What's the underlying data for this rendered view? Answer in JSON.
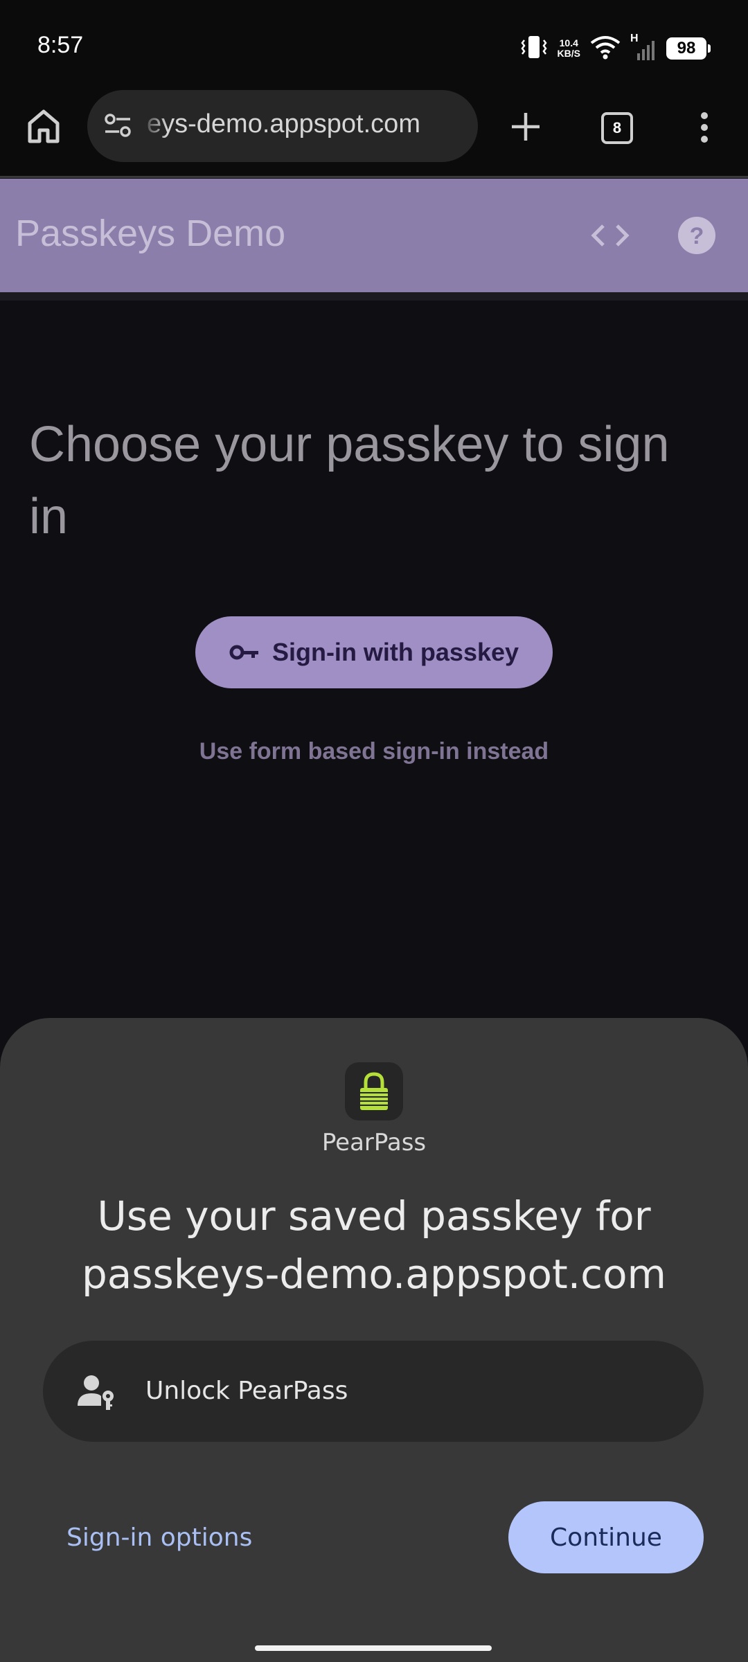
{
  "status_bar": {
    "time": "8:57",
    "net_speed_value": "10.4",
    "net_speed_unit": "KB/S",
    "network_type": "H",
    "battery_level": "98"
  },
  "browser": {
    "url": "eys-demo.appspot.com",
    "tab_count": "8"
  },
  "app_bar": {
    "title": "Passkeys Demo",
    "background_color": "#8c7eaa"
  },
  "page": {
    "heading": "Choose your passkey to sign in",
    "passkey_button_label": "Sign-in with passkey",
    "form_link_label": "Use form based sign-in instead"
  },
  "bottom_sheet": {
    "provider_name": "PearPass",
    "title": "Use your saved passkey for passkeys-demo.appspot.com",
    "unlock_label": "Unlock PearPass",
    "options_label": "Sign-in options",
    "continue_label": "Continue",
    "accent_color": "#b3c5fb",
    "icons": [
      "lock-icon",
      "person-key-icon"
    ]
  }
}
